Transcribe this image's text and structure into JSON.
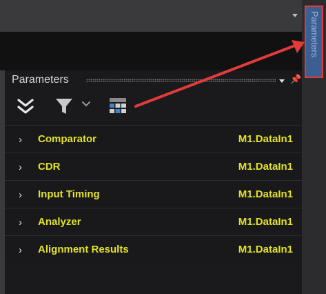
{
  "side_tab": {
    "label": "Parameters"
  },
  "panel": {
    "title": "Parameters",
    "rows": [
      {
        "name": "Comparator",
        "value": "M1.DataIn1"
      },
      {
        "name": "CDR",
        "value": "M1.DataIn1"
      },
      {
        "name": "Input Timing",
        "value": "M1.DataIn1"
      },
      {
        "name": "Analyzer",
        "value": "M1.DataIn1"
      },
      {
        "name": "Alignment Results",
        "value": "M1.DataIn1"
      }
    ]
  },
  "toolbar": {
    "icons": [
      "collapse-all-icon",
      "filter-icon",
      "chevron-down-icon",
      "grid-icon"
    ]
  },
  "icons": {
    "pin": "pin-icon",
    "panel_menu": "dropdown-icon",
    "row_expand": "chevron-right-icon"
  },
  "colors": {
    "accent_text": "#e3e321",
    "annotation_arrow": "#e23b3b",
    "side_tab_bg": "#3c5f93",
    "panel_bg": "#1a1a1c",
    "grid_icon": "#3f83c9"
  }
}
